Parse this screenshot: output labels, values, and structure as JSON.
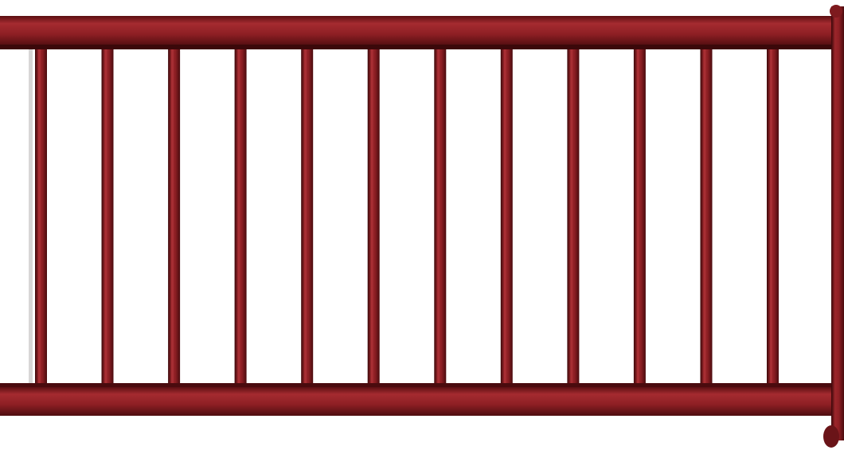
{
  "railing": {
    "baluster_count": 12,
    "colors": {
      "rail": "#8e1f24",
      "rail_highlight": "#b0353a",
      "rail_shadow": "#4f0d10",
      "edge": "#2a0506",
      "background": "#ffffff"
    }
  }
}
